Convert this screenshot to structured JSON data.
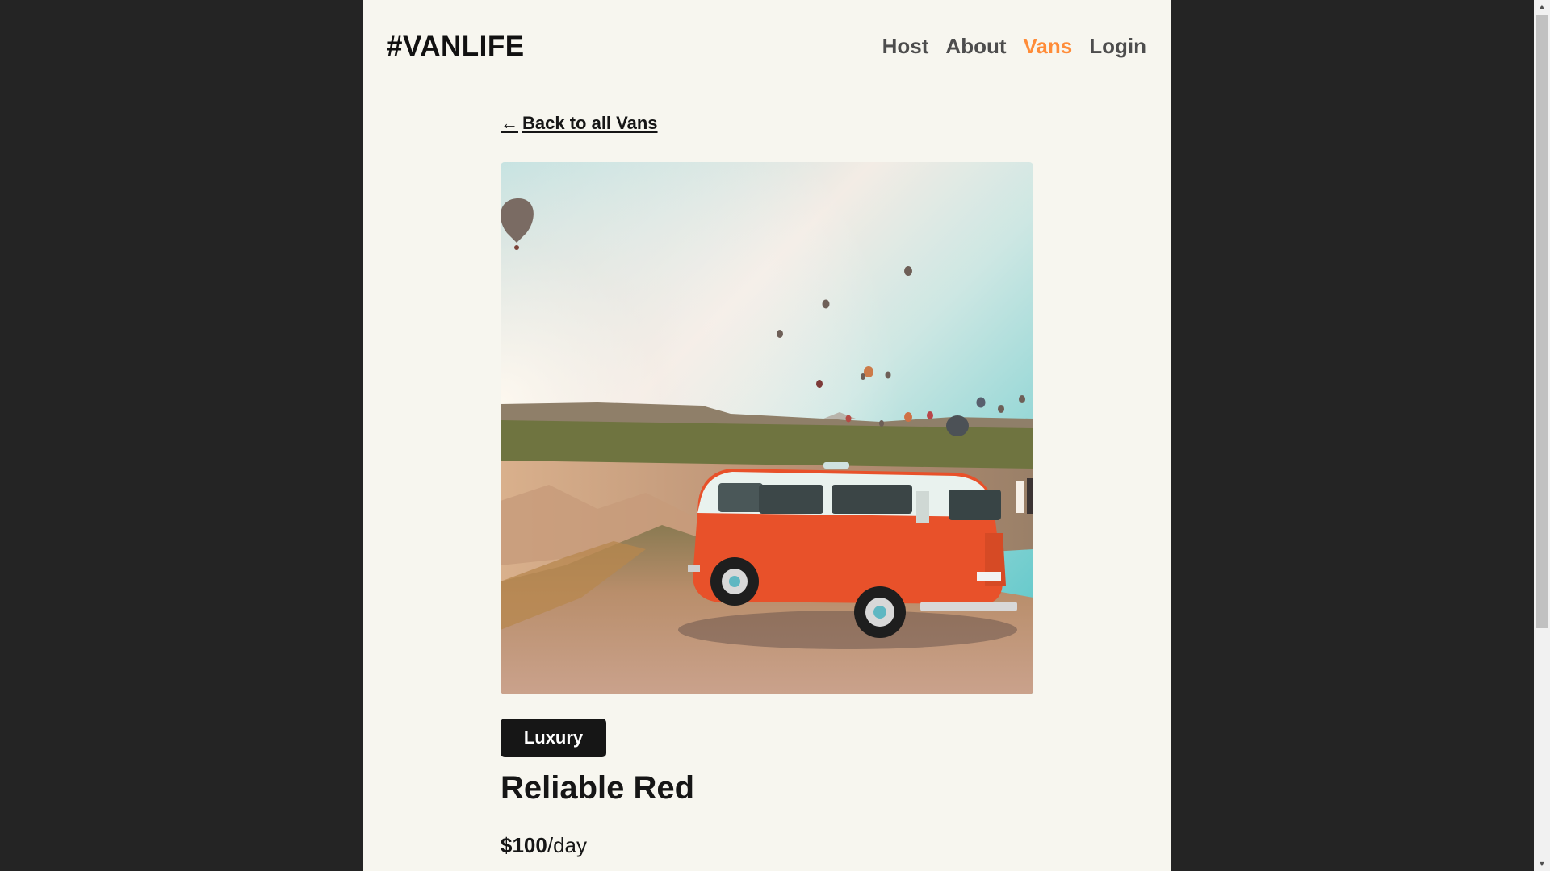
{
  "header": {
    "logo": "#VANLIFE",
    "nav": [
      {
        "label": "Host",
        "active": false
      },
      {
        "label": "About",
        "active": false
      },
      {
        "label": "Vans",
        "active": true
      },
      {
        "label": "Login",
        "active": false
      }
    ]
  },
  "van_detail": {
    "back_label": "Back to all Vans",
    "back_icon": "left-arrow-icon",
    "image_subject": "orange and white camper van on a cliff with hot air balloons",
    "type": "Luxury",
    "name": "Reliable Red",
    "price": "$100",
    "price_unit": "/day"
  },
  "colors": {
    "page_background": "#242424",
    "content_background": "#f7f6ef",
    "accent": "#ff8c38",
    "text": "#161616",
    "badge_background": "#161616"
  }
}
